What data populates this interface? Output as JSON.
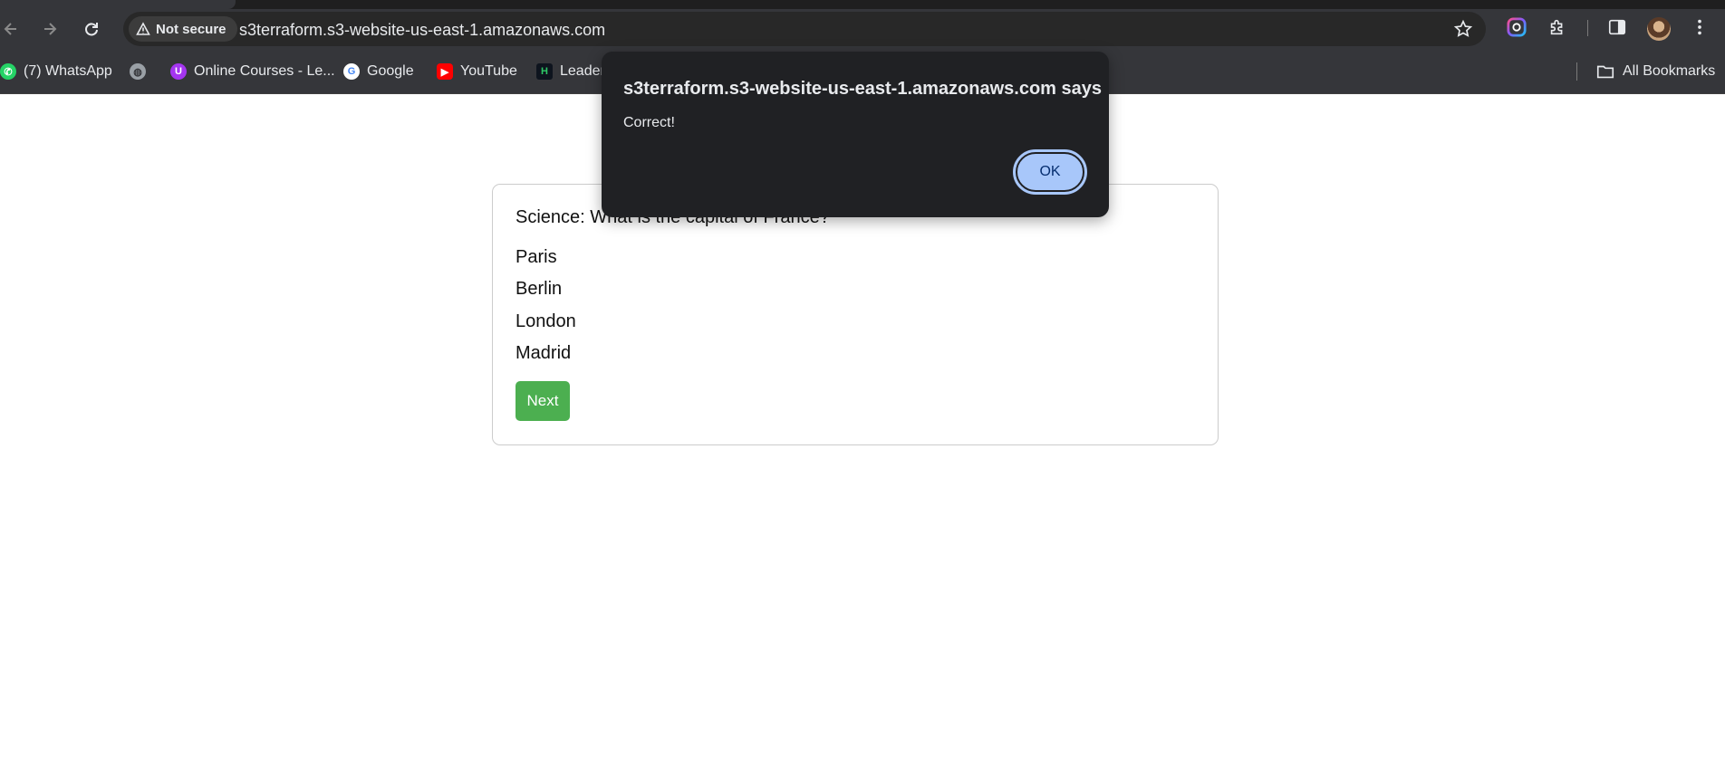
{
  "browser": {
    "security_label": "Not secure",
    "url": "s3terraform.s3-website-us-east-1.amazonaws.com",
    "bookmarks": [
      {
        "label": "(7) WhatsApp",
        "icon": "whatsapp-icon"
      },
      {
        "label": "",
        "icon": "globe-icon"
      },
      {
        "label": "Online Courses - Le...",
        "icon": "udemy-icon"
      },
      {
        "label": "Google",
        "icon": "google-icon"
      },
      {
        "label": "YouTube",
        "icon": "youtube-icon"
      },
      {
        "label": "Leader",
        "icon": "hackerrank-icon"
      }
    ],
    "all_bookmarks_label": "All Bookmarks"
  },
  "quiz": {
    "question": "Science: What is the capital of France?",
    "options": [
      "Paris",
      "Berlin",
      "London",
      "Madrid"
    ],
    "next_label": "Next"
  },
  "dialog": {
    "title": "s3terraform.s3-website-us-east-1.amazonaws.com says",
    "message": "Correct!",
    "ok_label": "OK"
  },
  "colors": {
    "chrome_bg": "#35363a",
    "next_button": "#4caf50",
    "ok_button": "#a8c7fa"
  }
}
